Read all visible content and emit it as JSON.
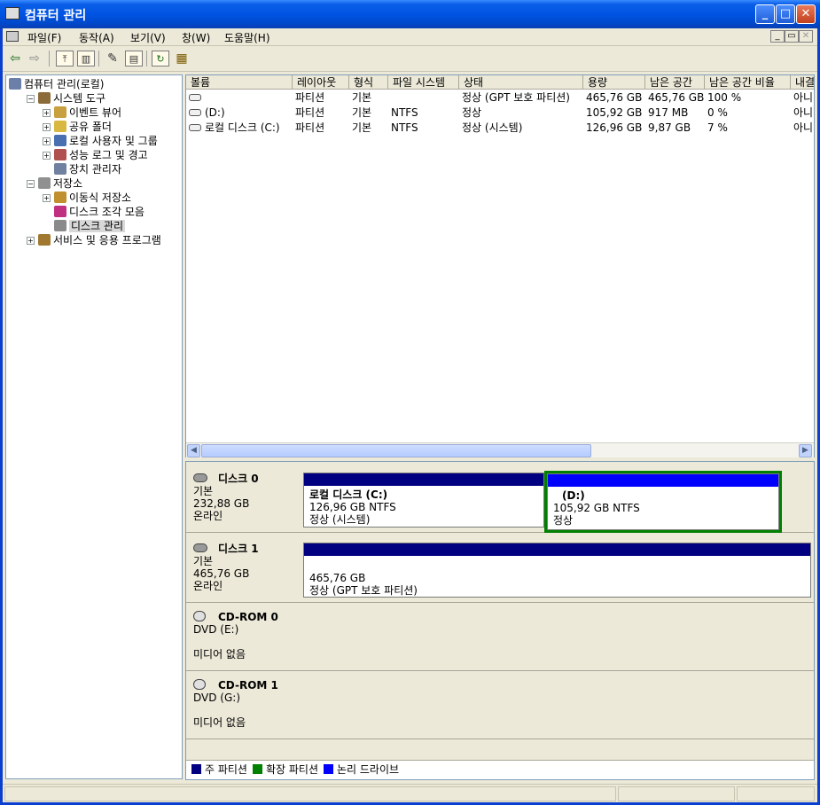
{
  "window": {
    "title": "컴퓨터 관리"
  },
  "menu": [
    "파일(F)",
    "동작(A)",
    "보기(V)",
    "창(W)",
    "도움말(H)"
  ],
  "toolbar_icons": [
    "back-arrow-icon",
    "forward-arrow-icon",
    "up-folder-icon",
    "show-hide-tree-icon",
    "properties-icon",
    "help-icon",
    "refresh-icon",
    "export-icon"
  ],
  "tree": [
    {
      "label": "컴퓨터 관리(로컬)",
      "icon": "computer-icon",
      "level": 0,
      "expander": ""
    },
    {
      "label": "시스템 도구",
      "icon": "system-tools-icon",
      "level": 1,
      "expander": "−"
    },
    {
      "label": "이벤트 뷰어",
      "icon": "event-viewer-icon",
      "level": 2,
      "expander": "+"
    },
    {
      "label": "공유 폴더",
      "icon": "shared-folder-icon",
      "level": 2,
      "expander": "+"
    },
    {
      "label": "로컬 사용자 및 그룹",
      "icon": "users-icon",
      "level": 2,
      "expander": "+"
    },
    {
      "label": "성능 로그 및 경고",
      "icon": "performance-icon",
      "level": 2,
      "expander": "+"
    },
    {
      "label": "장치 관리자",
      "icon": "device-manager-icon",
      "level": 2,
      "expander": ""
    },
    {
      "label": "저장소",
      "icon": "storage-icon",
      "level": 1,
      "expander": "−"
    },
    {
      "label": "이동식 저장소",
      "icon": "removable-storage-icon",
      "level": 2,
      "expander": "+"
    },
    {
      "label": "디스크 조각 모음",
      "icon": "defrag-icon",
      "level": 2,
      "expander": ""
    },
    {
      "label": "디스크 관리",
      "icon": "disk-management-icon",
      "level": 2,
      "expander": "",
      "selected": true
    },
    {
      "label": "서비스 및 응용 프로그램",
      "icon": "services-icon",
      "level": 1,
      "expander": "+"
    }
  ],
  "volumes": {
    "headers": [
      "볼륨",
      "레이아웃",
      "형식",
      "파일 시스템",
      "상태",
      "용량",
      "남은 공간",
      "남은 공간 비율",
      "내결"
    ],
    "rows": [
      [
        "",
        "파티션",
        "기본",
        "",
        "정상 (GPT 보호 파티션)",
        "465,76 GB",
        "465,76 GB",
        "100 %",
        "아니"
      ],
      [
        "(D:)",
        "파티션",
        "기본",
        "NTFS",
        "정상",
        "105,92 GB",
        "917 MB",
        "0 %",
        "아니"
      ],
      [
        "로컬 디스크 (C:)",
        "파티션",
        "기본",
        "NTFS",
        "정상 (시스템)",
        "126,96 GB",
        "9,87 GB",
        "7 %",
        "아니"
      ]
    ]
  },
  "disks": [
    {
      "name": "디스크 0",
      "type": "기본",
      "size": "232,88 GB",
      "status": "온라인",
      "icon": "hard-disk-icon",
      "partitions": [
        {
          "title": "로컬 디스크  (C:)",
          "line1": "126,96 GB NTFS",
          "line2": "정상 (시스템)",
          "color": "#000080",
          "selected": false
        },
        {
          "title": "(D:)",
          "line1": "105,92 GB NTFS",
          "line2": "정상",
          "color": "#0000ff",
          "selected": true
        }
      ]
    },
    {
      "name": "디스크 1",
      "type": "기본",
      "size": "465,76 GB",
      "status": "온라인",
      "icon": "hard-disk-icon",
      "partitions": [
        {
          "title": "",
          "line1": "465,76 GB",
          "line2": "정상 (GPT 보호 파티션)",
          "color": "#000080",
          "selected": false
        }
      ]
    },
    {
      "name": "CD-ROM 0",
      "drive": "DVD (E:)",
      "media": "미디어 없음",
      "icon": "cdrom-icon"
    },
    {
      "name": "CD-ROM 1",
      "drive": "DVD (G:)",
      "media": "미디어 없음",
      "icon": "cdrom-icon"
    }
  ],
  "legend": [
    {
      "label": "주 파티션",
      "color": "#000080"
    },
    {
      "label": "확장 파티션",
      "color": "#008000"
    },
    {
      "label": "논리 드라이브",
      "color": "#0000ff"
    }
  ],
  "colors": {
    "titlebar": "#0054e3",
    "selection_border": "#008000"
  }
}
